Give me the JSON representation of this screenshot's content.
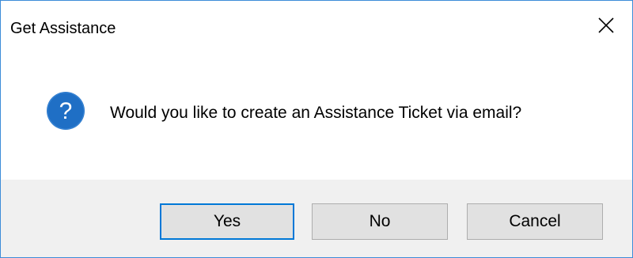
{
  "window": {
    "title": "Get Assistance"
  },
  "icons": {
    "close": "close-icon",
    "question": "question-icon"
  },
  "message": {
    "text": "Would you like to create an Assistance Ticket via email?"
  },
  "buttons": {
    "yes_label": "Yes",
    "no_label": "No",
    "cancel_label": "Cancel"
  },
  "colors": {
    "accent": "#0078d7",
    "icon_blue": "#1f6fc5",
    "footer_bg": "#f0f0f0",
    "button_bg": "#e1e1e1"
  }
}
